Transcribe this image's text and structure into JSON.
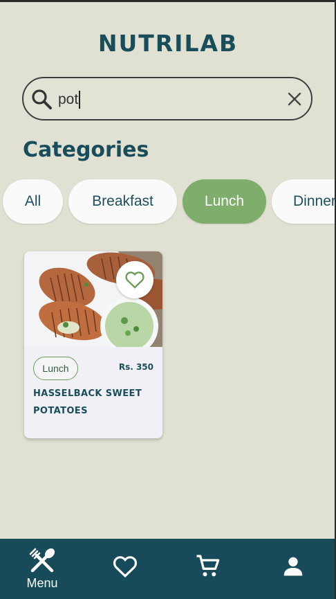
{
  "app": {
    "title": "NUTRILAB"
  },
  "search": {
    "value": "pot",
    "placeholder": ""
  },
  "categories": {
    "title": "Categories",
    "items": [
      {
        "label": "All",
        "active": false
      },
      {
        "label": "Breakfast",
        "active": false
      },
      {
        "label": "Lunch",
        "active": true
      },
      {
        "label": "Dinner",
        "active": false
      }
    ]
  },
  "results": [
    {
      "category": "Lunch",
      "price": "Rs. 350",
      "name": "HASSELBACK SWEET POTATOES",
      "favorite": false,
      "image": "hasselback-sweet-potatoes-photo"
    }
  ],
  "bottom_nav": {
    "items": [
      {
        "label": "Menu",
        "icon": "fork-knife-icon",
        "active": true
      },
      {
        "label": "",
        "icon": "heart-icon",
        "active": false
      },
      {
        "label": "",
        "icon": "cart-icon",
        "active": false
      },
      {
        "label": "",
        "icon": "person-icon",
        "active": false
      }
    ]
  },
  "colors": {
    "background": "#e0e1d2",
    "brand": "#1a4d5a",
    "accent": "#7ead6c",
    "nav": "#174b59",
    "card": "#f1f0f6"
  }
}
